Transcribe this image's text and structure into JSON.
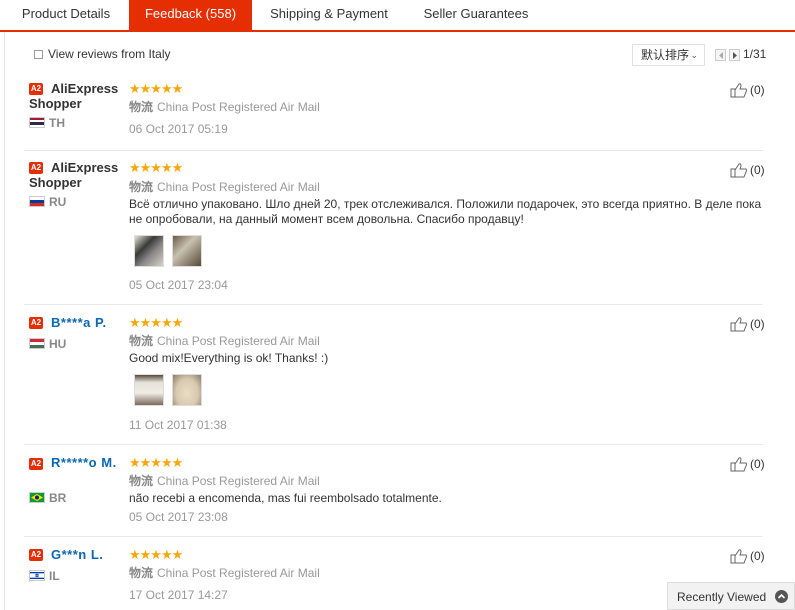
{
  "tabs": [
    {
      "label": "Product Details",
      "active": false
    },
    {
      "label": "Feedback (558)",
      "active": true
    },
    {
      "label": "Shipping & Payment",
      "active": false
    },
    {
      "label": "Seller Guarantees",
      "active": false
    }
  ],
  "toolbar": {
    "italy_checkbox_label": "View reviews from Italy",
    "italy_checked": false,
    "sort_value": "默认排序",
    "page": "1/31"
  },
  "reviews": [
    {
      "badge": "A2",
      "username": "AliExpress Shopper",
      "country": "TH",
      "rating": 5,
      "logistics_label": "物流",
      "logistics": "China Post Registered Air Mail",
      "text": "",
      "date": "06 Oct 2017 05:19",
      "helpful": "(0)"
    },
    {
      "badge": "A2",
      "username": "AliExpress Shopper",
      "country": "RU",
      "rating": 5,
      "logistics_label": "物流",
      "logistics": "China Post Registered Air Mail",
      "text": "Всё отлично упаковано. Шло дней 20, трек отслеживался. Положили подарочек, это всегда приятно. В деле пока не опробовали, на данный момент всем довольна. Спасибо продавцу!",
      "date": "05 Oct 2017 23:04",
      "helpful": "(0)"
    },
    {
      "badge": "A2",
      "username": "B****a P.",
      "country": "HU",
      "rating": 5,
      "logistics_label": "物流",
      "logistics": "China Post Registered Air Mail",
      "text": "Good mix!Everything is ok! Thanks! :)",
      "date": "11 Oct 2017 01:38",
      "helpful": "(0)"
    },
    {
      "badge": "A2",
      "username": "R*****o M.",
      "country": "BR",
      "rating": 5,
      "logistics_label": "物流",
      "logistics": "China Post Registered Air Mail",
      "text": "não recebi a encomenda, mas fui reembolsado totalmente.",
      "date": "05 Oct 2017 23:08",
      "helpful": "(0)"
    },
    {
      "badge": "A2",
      "username": "G***n L.",
      "country": "IL",
      "rating": 5,
      "logistics_label": "物流",
      "logistics": "China Post Registered Air Mail",
      "text": "",
      "date": "17 Oct 2017 14:27",
      "helpful": "(0)"
    }
  ],
  "recently_viewed": "Recently Viewed",
  "colors": {
    "accent": "#e62e04",
    "star": "#f7a70b",
    "username_blue": "#0a68b4"
  },
  "icons": {
    "helpful": "thumbs-up-icon",
    "recent": "chevron-up-icon",
    "stars": "star-icon"
  }
}
